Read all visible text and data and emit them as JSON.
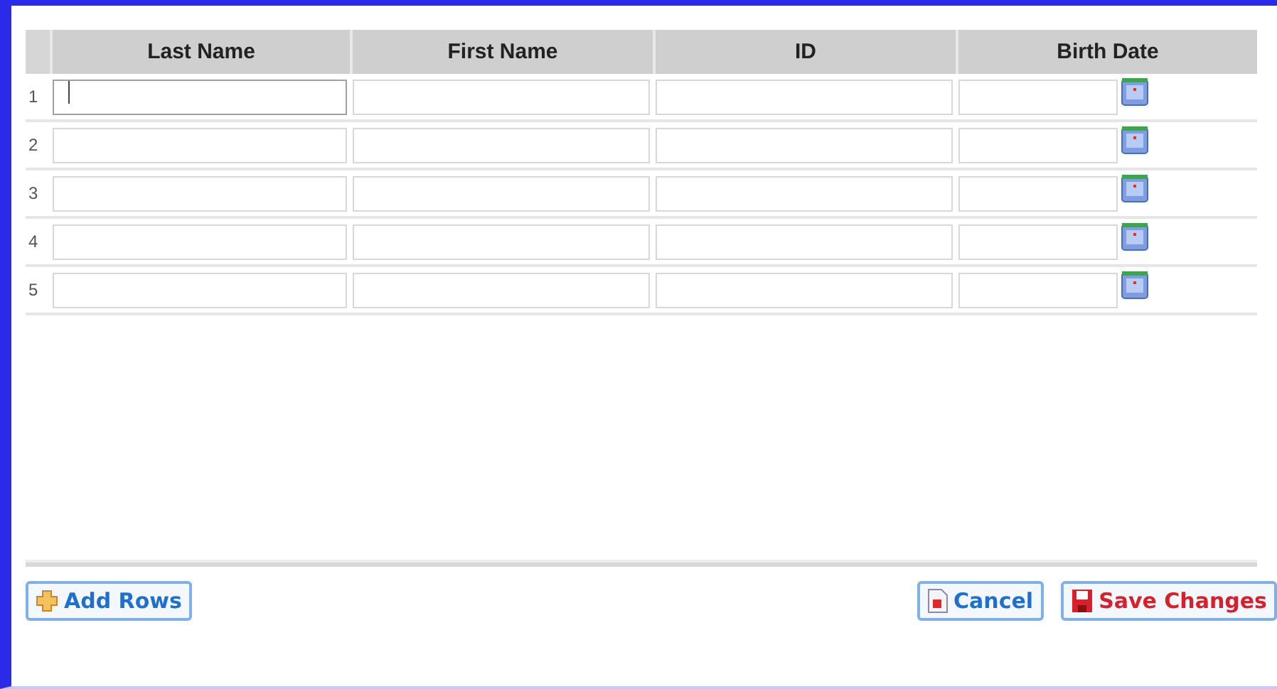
{
  "table": {
    "columns": [
      "Last Name",
      "First Name",
      "ID",
      "Birth Date"
    ],
    "rows": [
      {
        "number": "1",
        "focused": true
      },
      {
        "number": "2",
        "focused": false
      },
      {
        "number": "3",
        "focused": false
      },
      {
        "number": "4",
        "focused": false
      },
      {
        "number": "5",
        "focused": false
      }
    ]
  },
  "buttons": [
    {
      "kind": "add",
      "label": "Add Rows"
    },
    {
      "kind": "cancel",
      "label": "Cancel"
    },
    {
      "kind": "save",
      "label": "Save Changes"
    }
  ]
}
